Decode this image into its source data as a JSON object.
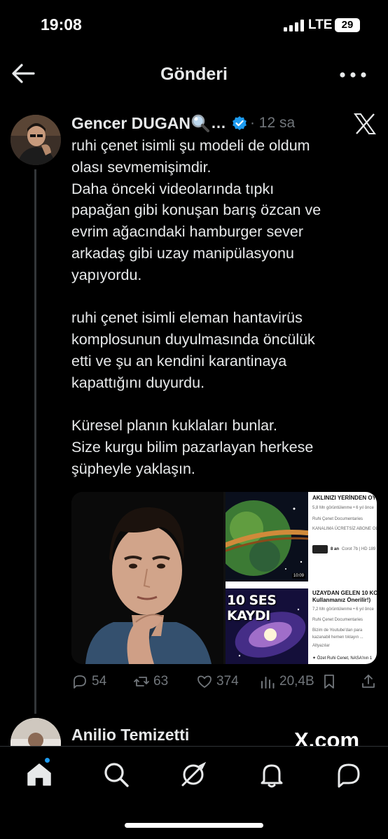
{
  "status_bar": {
    "time": "19:08",
    "network": "LTE",
    "battery": "29"
  },
  "header": {
    "title": "Gönderi"
  },
  "tweet": {
    "author_name": "Gencer DUGAN",
    "author_name_suffix": "…",
    "time": "· 12 sa",
    "paragraphs": [
      "ruhi çenet isimli şu modeli de oldum\nolası sevmemişimdir.\nDaha önceki videolarında tıpkı\npapağan gibi konuşan barış özcan ve\nevrim ağacındaki hamburger sever\narkadaş gibi uzay manipülasyonu\nyapıyordu.",
      "ruhi çenet isimli eleman hantavirüs\nkomplosunun duyulmasında öncülük\netti ve şu an kendini karantinaya\nkapattığını duyurdu.",
      "Küresel planın kuklaları bunlar.\nSize kurgu bilim pazarlayan herkese\nşüpheyle yaklaşın."
    ],
    "media": {
      "video1": {
        "title": "AKLINIZI YERİNDEN OY",
        "meta": "5,8 Mn görüntülenme • 6 yıl önce",
        "channel": "Ruhi Çenet Documentaries",
        "subscribe": "KANALIMA ÜCRETSİZ ABONE OLUN",
        "duration": "10:09",
        "chip_time": "8 an",
        "chip_text": "Corot 7b | HD 189"
      },
      "video2": {
        "thumb_text": "10 SES KAYDI",
        "title": "UZAYDAN GELEN 10 KOR",
        "subtitle": "Kullanmanız Önerilir!)",
        "meta": "7,2 Mn görüntülenme • 6 yıl önce",
        "channel": "Ruhi Çenet Documentaries",
        "desc": "Bizim de Youtube'dan para kazanabil hemen tıklayın ...",
        "tag": "Altyazılar",
        "summary": "✦ Özet  Ruhi Cenet, NASA'nın 1"
      }
    },
    "stats": {
      "replies": "54",
      "reposts": "63",
      "likes": "374",
      "views": "20,4B"
    }
  },
  "reply": {
    "author_name": "Anilio Temizetti"
  },
  "watermark": "X.com",
  "colors": {
    "accent": "#1d9bf0",
    "muted": "#71767b",
    "text": "#e7e9ea",
    "background": "#000000"
  },
  "nav": {
    "items": [
      "home-icon",
      "search-icon",
      "grok-icon",
      "notifications-icon",
      "messages-icon"
    ],
    "home_has_notification": true
  }
}
